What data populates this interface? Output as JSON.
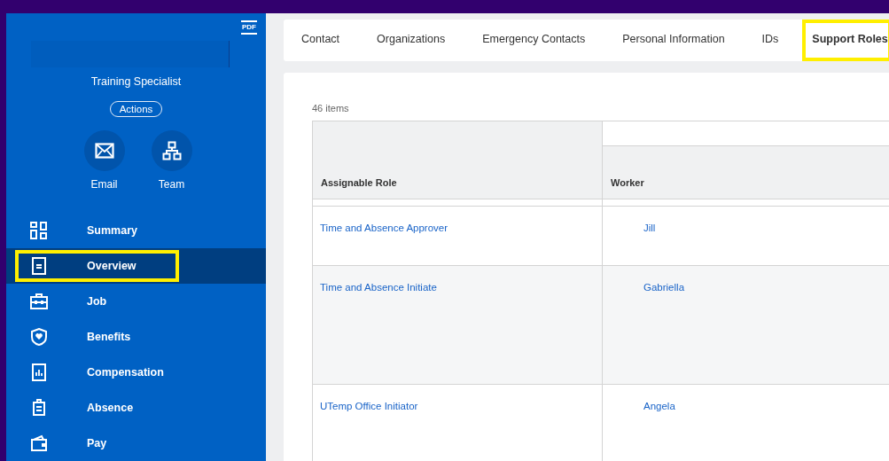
{
  "profile": {
    "pdf_label": "PDF",
    "job_title": "Training Specialist",
    "actions_button": "Actions",
    "quick_actions": [
      {
        "kind": "email",
        "label": "Email"
      },
      {
        "kind": "team",
        "label": "Team"
      }
    ]
  },
  "sidebar": {
    "items": [
      {
        "kind": "summary",
        "label": "Summary",
        "selected": false,
        "highlighted": false
      },
      {
        "kind": "overview",
        "label": "Overview",
        "selected": true,
        "highlighted": true
      },
      {
        "kind": "job",
        "label": "Job",
        "selected": false,
        "highlighted": false
      },
      {
        "kind": "benefits",
        "label": "Benefits",
        "selected": false,
        "highlighted": false
      },
      {
        "kind": "compensation",
        "label": "Compensation",
        "selected": false,
        "highlighted": false
      },
      {
        "kind": "absence",
        "label": "Absence",
        "selected": false,
        "highlighted": false
      },
      {
        "kind": "pay",
        "label": "Pay",
        "selected": false,
        "highlighted": false
      }
    ]
  },
  "tabs": [
    {
      "label": "Contact",
      "selected": false,
      "highlighted": false
    },
    {
      "label": "Organizations",
      "selected": false,
      "highlighted": false
    },
    {
      "label": "Emergency Contacts",
      "selected": false,
      "highlighted": false
    },
    {
      "label": "Personal Information",
      "selected": false,
      "highlighted": false
    },
    {
      "label": "IDs",
      "selected": false,
      "highlighted": false
    },
    {
      "label": "Support Roles",
      "selected": true,
      "highlighted": true
    }
  ],
  "table": {
    "count": "46 items",
    "columns": [
      "Assignable Role",
      "Worker"
    ],
    "rows": [
      {
        "role": "Time and Absence Approver",
        "worker": "Jill"
      },
      {
        "role": "Time and Absence Initiate",
        "worker": "Gabriella"
      },
      {
        "role": "UTemp Office Initiator",
        "worker": "Angela"
      }
    ]
  }
}
